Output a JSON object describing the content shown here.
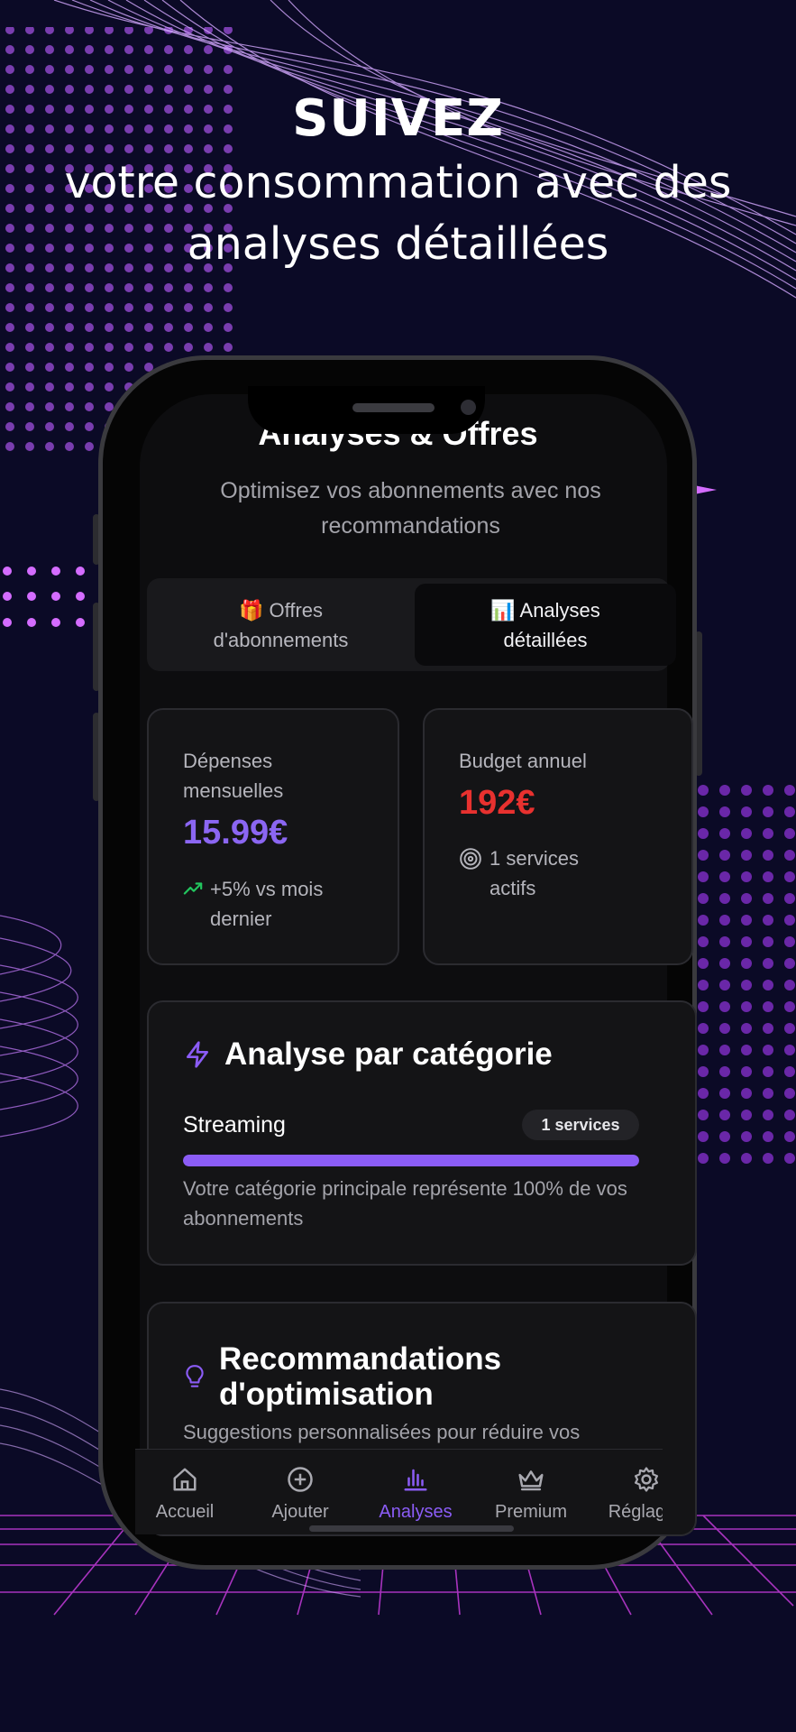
{
  "hero": {
    "title": "SUIVEZ",
    "subtitle_line1": "votre consommation avec des",
    "subtitle_line2": "analyses détaillées"
  },
  "app": {
    "title": "Analyses & Offres",
    "subtitle": "Optimisez vos abonnements avec nos recommandations"
  },
  "tabs": [
    {
      "emoji": "🎁",
      "line1": "Offres",
      "line2": "d'abonnements",
      "active": false
    },
    {
      "emoji": "📊",
      "line1": "Analyses",
      "line2": "détaillées",
      "active": true
    }
  ],
  "stats": {
    "monthly": {
      "label": "Dépenses mensuelles",
      "value": "15.99€",
      "trend": "+5% vs mois dernier"
    },
    "annual": {
      "label": "Budget annuel",
      "value": "192€",
      "services": "1 services actifs"
    }
  },
  "category": {
    "title": "Analyse par catégorie",
    "name": "Streaming",
    "badge": "1 services",
    "share_percent": 100,
    "note": "Votre catégorie principale représente 100% de vos abonnements"
  },
  "recommendations": {
    "title": "Recommandations d'optimisation",
    "subtitle": "Suggestions personnalisées pour réduire vos"
  },
  "nav": [
    {
      "label": "Accueil",
      "icon": "home-icon",
      "active": false
    },
    {
      "label": "Ajouter",
      "icon": "plus-circle-icon",
      "active": false
    },
    {
      "label": "Analyses",
      "icon": "bar-chart-icon",
      "active": true
    },
    {
      "label": "Premium",
      "icon": "crown-icon",
      "active": false
    },
    {
      "label": "Réglages",
      "icon": "gear-icon",
      "active": false
    }
  ],
  "colors": {
    "accent": "#8b5cf6",
    "danger": "#e8312f",
    "trend": "#22c55e",
    "background": "#0b0a26"
  }
}
